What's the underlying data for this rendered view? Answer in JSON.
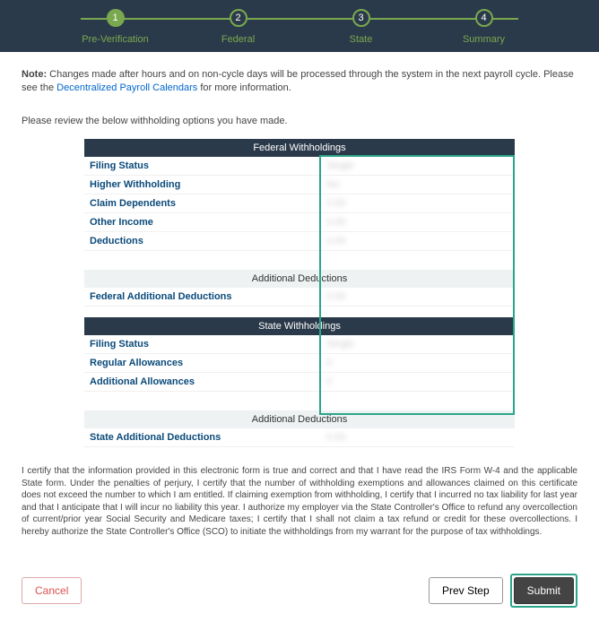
{
  "stepper": {
    "steps": [
      {
        "num": "1",
        "label": "Pre-Verification"
      },
      {
        "num": "2",
        "label": "Federal"
      },
      {
        "num": "3",
        "label": "State"
      },
      {
        "num": "4",
        "label": "Summary"
      }
    ]
  },
  "note": {
    "label": "Note:",
    "text": " Changes made after hours and on non-cycle days will be processed through the system in the next payroll cycle. Please see the ",
    "link": "Decentralized Payroll Calendars",
    "tail": " for more information."
  },
  "review": "Please review the below withholding options you have made.",
  "federal": {
    "header": "Federal Withholdings",
    "rows": [
      {
        "label": "Filing Status",
        "value": "Single"
      },
      {
        "label": "Higher Withholding",
        "value": "No"
      },
      {
        "label": "Claim Dependents",
        "value": "0.00"
      },
      {
        "label": "Other Income",
        "value": "0.00"
      },
      {
        "label": "Deductions",
        "value": "0.00"
      }
    ],
    "subheader": "Additional Deductions",
    "add_label": "Federal Additional Deductions",
    "add_value": "0.00"
  },
  "state": {
    "header": "State Withholdings",
    "rows": [
      {
        "label": "Filing Status",
        "value": "Single"
      },
      {
        "label": "Regular Allowances",
        "value": "0"
      },
      {
        "label": "Additional Allowances",
        "value": "0"
      }
    ],
    "subheader": "Additional Deductions",
    "add_label": "State Additional Deductions",
    "add_value": "0.00"
  },
  "certification": "I certify that the information provided in this electronic form is true and correct and that I have read the IRS Form W-4 and the applicable State form. Under the penalties of perjury, I certify that the number of withholding exemptions and allowances claimed on this certificate does not exceed the number to which I am entitled. If claiming exemption from withholding, I certify that I incurred no tax liability for last year and that I anticipate that I will incur no liability this year. I authorize my employer via the State Controller's Office to refund any overcollection of current/prior year Social Security and Medicare taxes; I certify that I shall not claim a tax refund or credit for these overcollections. I hereby authorize the State Controller's Office (SCO) to initiate the withholdings from my warrant for the purpose of tax withholdings.",
  "buttons": {
    "cancel": "Cancel",
    "prev": "Prev Step",
    "submit": "Submit"
  }
}
